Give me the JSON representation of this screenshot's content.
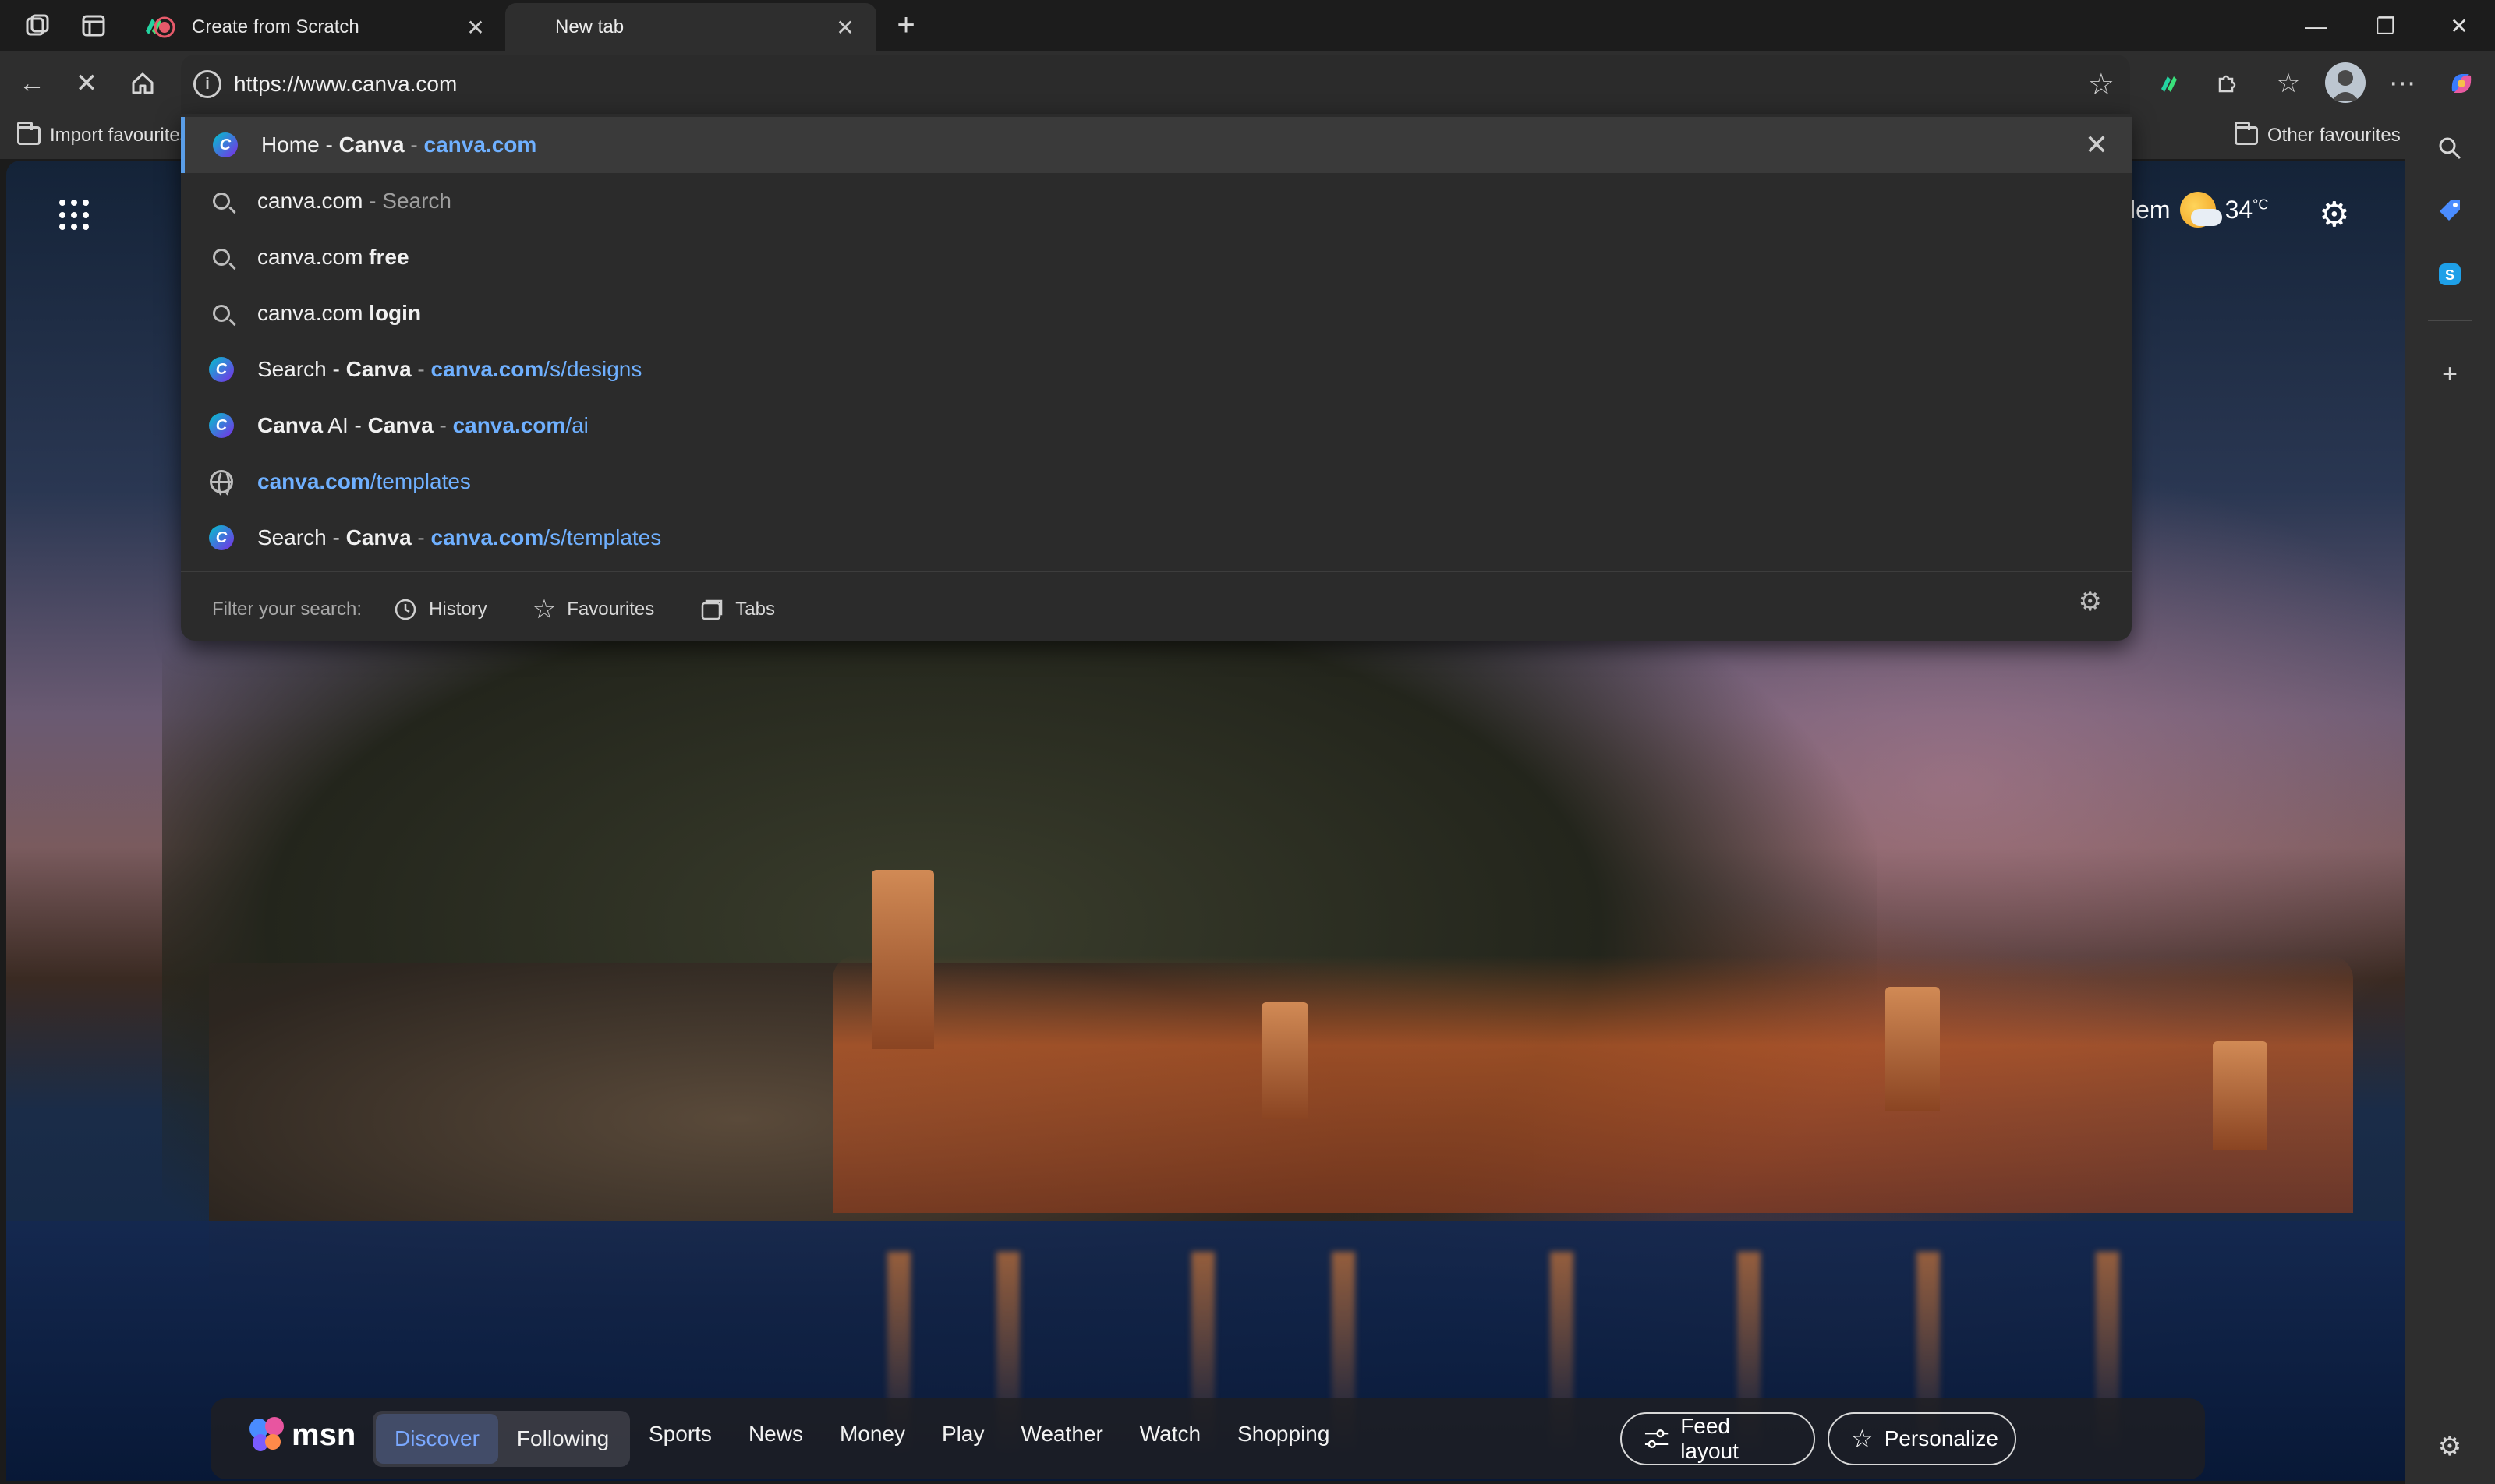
{
  "tabs": [
    {
      "title": "Create from Scratch",
      "state": "inactive"
    },
    {
      "title": "New tab",
      "state": "active"
    }
  ],
  "toolbar": {
    "url": "https://www.canva.com"
  },
  "favorites_bar": {
    "import_label": "Import favourites",
    "other_label": "Other favourites"
  },
  "suggestions": [
    {
      "icon": "canva-icon",
      "parts": [
        {
          "t": "Home - ",
          "s": "n"
        },
        {
          "t": "Canva",
          "s": "b"
        },
        {
          "t": " - ",
          "s": "dim"
        },
        {
          "t": "canva.com",
          "s": "urlb"
        }
      ]
    },
    {
      "icon": "search-icon",
      "parts": [
        {
          "t": "canva.com",
          "s": "n"
        },
        {
          "t": " - Search",
          "s": "dim"
        }
      ]
    },
    {
      "icon": "search-icon",
      "parts": [
        {
          "t": "canva.com ",
          "s": "n"
        },
        {
          "t": "free",
          "s": "b"
        }
      ]
    },
    {
      "icon": "search-icon",
      "parts": [
        {
          "t": "canva.com ",
          "s": "n"
        },
        {
          "t": "login",
          "s": "b"
        }
      ]
    },
    {
      "icon": "canva-icon",
      "parts": [
        {
          "t": "Search - ",
          "s": "n"
        },
        {
          "t": "Canva",
          "s": "b"
        },
        {
          "t": " - ",
          "s": "dim"
        },
        {
          "t": "canva.com",
          "s": "urlb"
        },
        {
          "t": "/s/designs",
          "s": "url"
        }
      ]
    },
    {
      "icon": "canva-icon",
      "parts": [
        {
          "t": "Canva",
          "s": "b"
        },
        {
          "t": " AI - ",
          "s": "n"
        },
        {
          "t": "Canva",
          "s": "b"
        },
        {
          "t": " - ",
          "s": "dim"
        },
        {
          "t": "canva.com",
          "s": "urlb"
        },
        {
          "t": "/ai",
          "s": "url"
        }
      ]
    },
    {
      "icon": "globe-icon",
      "parts": [
        {
          "t": "canva.com",
          "s": "urlb"
        },
        {
          "t": "/templates",
          "s": "url"
        }
      ]
    },
    {
      "icon": "canva-icon",
      "parts": [
        {
          "t": "Search - ",
          "s": "n"
        },
        {
          "t": "Canva",
          "s": "b"
        },
        {
          "t": " - ",
          "s": "dim"
        },
        {
          "t": "canva.com",
          "s": "urlb"
        },
        {
          "t": "/s/templates",
          "s": "url"
        }
      ]
    }
  ],
  "filter": {
    "label": "Filter your search:",
    "history": "History",
    "favourites": "Favourites",
    "tabs": "Tabs"
  },
  "weather": {
    "location_fragment": "lem",
    "temp": "34",
    "unit": "°C"
  },
  "msn": {
    "logo": "msn",
    "discover": "Discover",
    "following": "Following",
    "nav": [
      "Sports",
      "News",
      "Money",
      "Play",
      "Weather",
      "Watch",
      "Shopping"
    ],
    "feed_layout": "Feed layout",
    "personalize": "Personalize"
  },
  "colors": {
    "accent_blue": "#6fb0ff",
    "selected_bar": "#5a9ee8",
    "chrome_bg": "#2e2e2e"
  }
}
